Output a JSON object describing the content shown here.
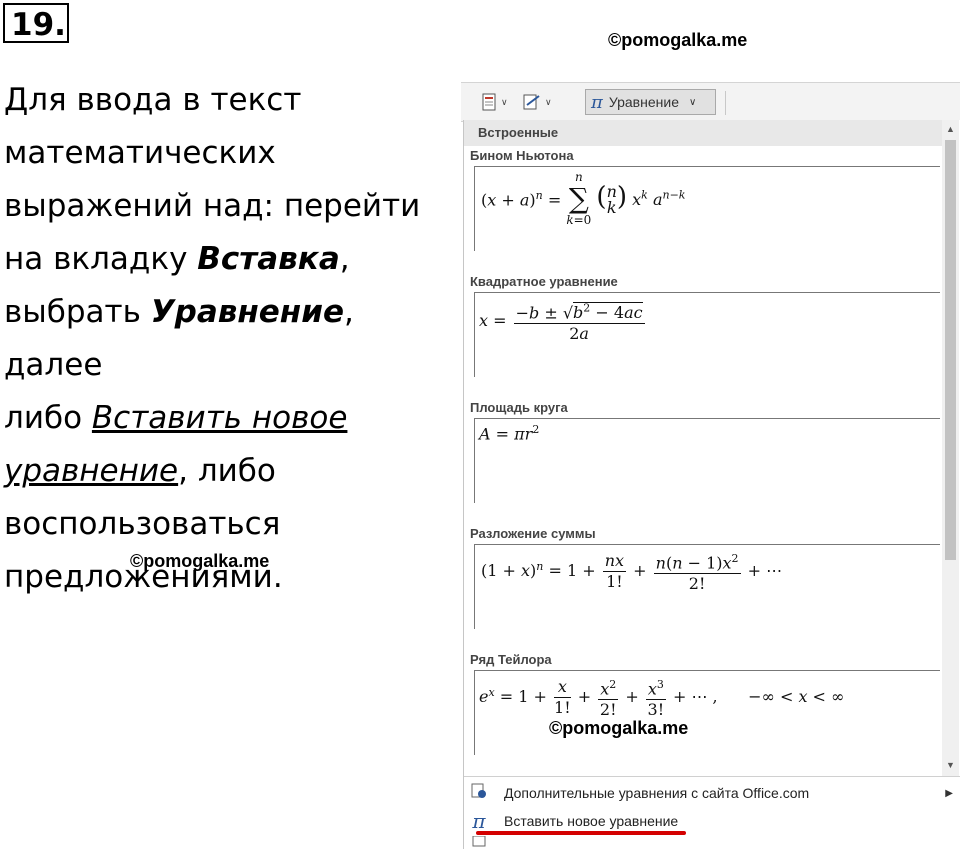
{
  "task_number": "19.",
  "watermarks": [
    "©pomogalka.me",
    "©pomogalka.me",
    "©pomogalka.me"
  ],
  "instruction": {
    "line1": "Для ввода в текст",
    "line2": "математических",
    "line3": "выражений над: перейти",
    "line4_a": "на вкладку ",
    "line4_b": "Вставка",
    "line4_c": ",",
    "line5_a": "выбрать ",
    "line5_b": "Уравнение",
    "line5_c": ", далее",
    "line6_a": "либо ",
    "line6_b": "Вставить новое",
    "line7_a": "уравнение",
    "line7_b": ", либо",
    "line8": "воспользоваться",
    "line9": "предложениями."
  },
  "toolbar": {
    "equation_label": "Уравнение",
    "icons": [
      "document-parts-icon",
      "signature-icon",
      "pi-icon"
    ]
  },
  "dropdown": {
    "category": "Встроенные",
    "items": [
      {
        "title": "Бином Ньютона"
      },
      {
        "title": "Квадратное уравнение"
      },
      {
        "title": "Площадь круга"
      },
      {
        "title": "Разложение суммы"
      },
      {
        "title": "Ряд Тейлора"
      }
    ],
    "menu": [
      {
        "label": "Дополнительные уравнения с сайта Office.com"
      },
      {
        "label": "Вставить новое уравнение"
      }
    ]
  },
  "colors": {
    "highlight": "#d40000",
    "pi_accent": "#2b579a"
  }
}
